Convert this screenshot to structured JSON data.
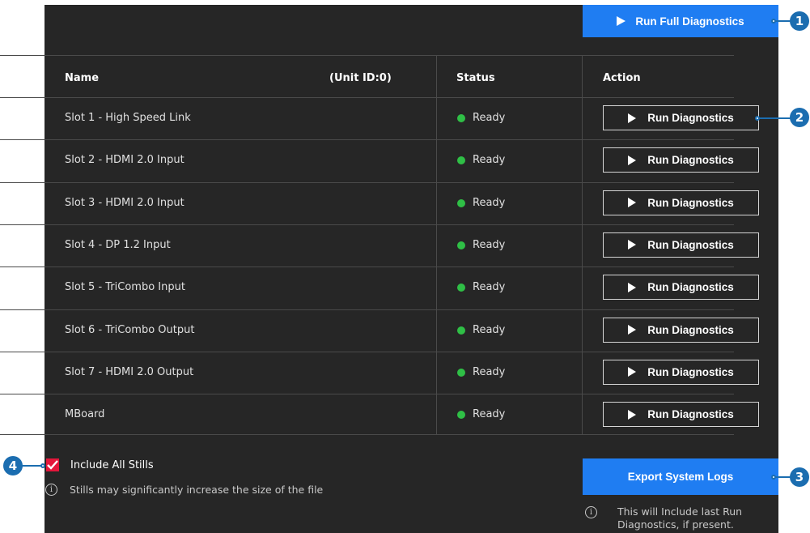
{
  "toolbar": {
    "run_full_label": "Run Full Diagnostics"
  },
  "table": {
    "headers": {
      "name": "Name",
      "unit_id": "(Unit ID:0)",
      "status": "Status",
      "action": "Action"
    },
    "rows": [
      {
        "name": "Slot 1 - High Speed Link",
        "status": "Ready",
        "action": "Run Diagnostics"
      },
      {
        "name": "Slot 2 - HDMI 2.0 Input",
        "status": "Ready",
        "action": "Run Diagnostics"
      },
      {
        "name": "Slot 3 - HDMI 2.0 Input",
        "status": "Ready",
        "action": "Run Diagnostics"
      },
      {
        "name": "Slot 4 - DP 1.2 Input",
        "status": "Ready",
        "action": "Run Diagnostics"
      },
      {
        "name": "Slot 5 - TriCombo Input",
        "status": "Ready",
        "action": "Run Diagnostics"
      },
      {
        "name": "Slot 6 - TriCombo Output",
        "status": "Ready",
        "action": "Run Diagnostics"
      },
      {
        "name": "Slot 7 - HDMI 2.0 Output",
        "status": "Ready",
        "action": "Run Diagnostics"
      },
      {
        "name": "MBoard",
        "status": "Ready",
        "action": "Run Diagnostics"
      }
    ]
  },
  "footer": {
    "include_stills_label": "Include All Stills",
    "include_stills_checked": true,
    "stills_note": "Stills may significantly increase the size of the file",
    "export_label": "Export System Logs",
    "export_note": "This will Include last Run Diagnostics, if present."
  },
  "callouts": [
    "1",
    "2",
    "3",
    "4"
  ],
  "colors": {
    "accent": "#1f7df2",
    "status_ready": "#2fbf46",
    "checkbox": "#e4163b",
    "callout": "#1b6db0",
    "panel": "#262626"
  },
  "icons": {
    "play": "play-icon",
    "check": "check-icon",
    "info": "info-icon"
  }
}
